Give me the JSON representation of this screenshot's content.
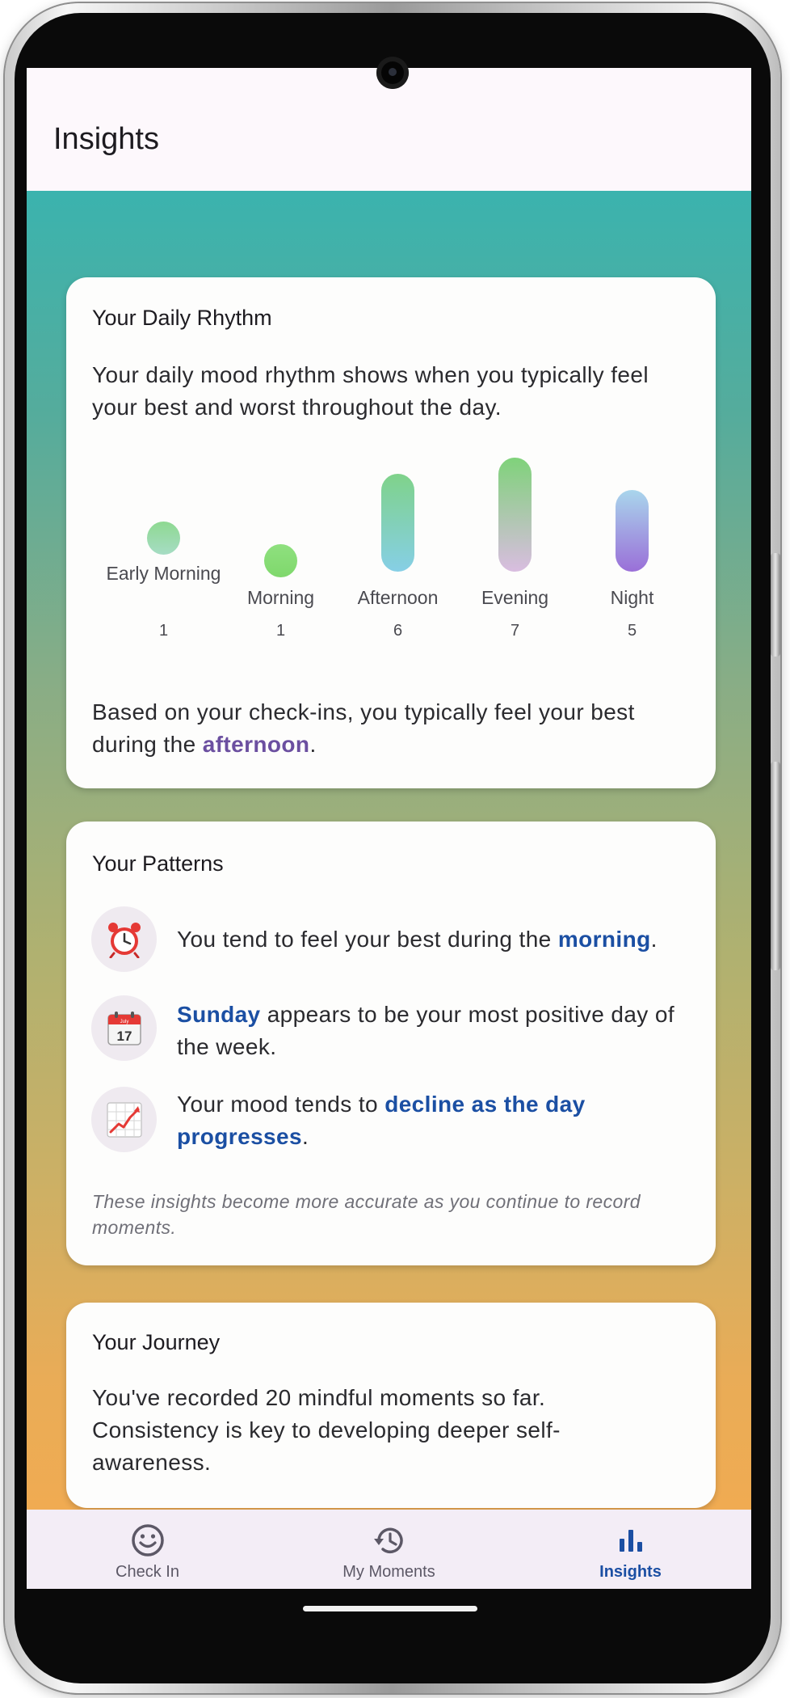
{
  "app": {
    "title": "Insights"
  },
  "rhythm_card": {
    "title": "Your Daily Rhythm",
    "description": "Your daily mood rhythm shows when you typically feel your best and worst throughout the day.",
    "periods": [
      {
        "label": "Early Morning",
        "count": "1",
        "gradient_top": "#8ed991",
        "gradient_bottom": "#a6dcc4"
      },
      {
        "label": "Morning",
        "count": "1",
        "gradient_top": "#8fe07f",
        "gradient_bottom": "#7fd86c"
      },
      {
        "label": "Afternoon",
        "count": "6",
        "gradient_top": "#7fd28a",
        "gradient_bottom": "#86cfe6"
      },
      {
        "label": "Evening",
        "count": "7",
        "gradient_top": "#7fd27a",
        "gradient_bottom": "#d9bde0"
      },
      {
        "label": "Night",
        "count": "5",
        "gradient_top": "#a9d6ec",
        "gradient_bottom": "#9a6fd8"
      }
    ],
    "summary_prefix": "Based on your check-ins, you typically feel your best during the ",
    "summary_highlight": "afternoon",
    "summary_suffix": "."
  },
  "patterns_card": {
    "title": "Your Patterns",
    "items": [
      {
        "icon": "alarm-clock-icon",
        "prefix": "You tend to feel your best during the ",
        "highlight": "morning",
        "suffix": "."
      },
      {
        "icon": "calendar-icon",
        "calendar_month": "July",
        "calendar_day": "17",
        "prefix": "",
        "highlight": "Sunday",
        "suffix": " appears to be your most positive day of the week."
      },
      {
        "icon": "chart-increasing-icon",
        "prefix": "Your mood tends to ",
        "highlight": "decline as the day progresses",
        "suffix": "."
      }
    ],
    "note": "These insights become more accurate as you continue to record moments."
  },
  "journey_card": {
    "title": "Your Journey",
    "text": "You've recorded 20 mindful moments so far. Consistency is key to developing deeper self-awareness."
  },
  "bottom_nav": {
    "items": [
      {
        "label": "Check In",
        "icon": "smiley-icon",
        "active": false
      },
      {
        "label": "My Moments",
        "icon": "history-icon",
        "active": false
      },
      {
        "label": "Insights",
        "icon": "bar-chart-icon",
        "active": true
      }
    ]
  },
  "colors": {
    "accent_blue": "#1b4fa3",
    "accent_purple": "#6b4fa0",
    "gradient_top": "#3bb3ae",
    "gradient_bottom": "#f0ab52"
  }
}
